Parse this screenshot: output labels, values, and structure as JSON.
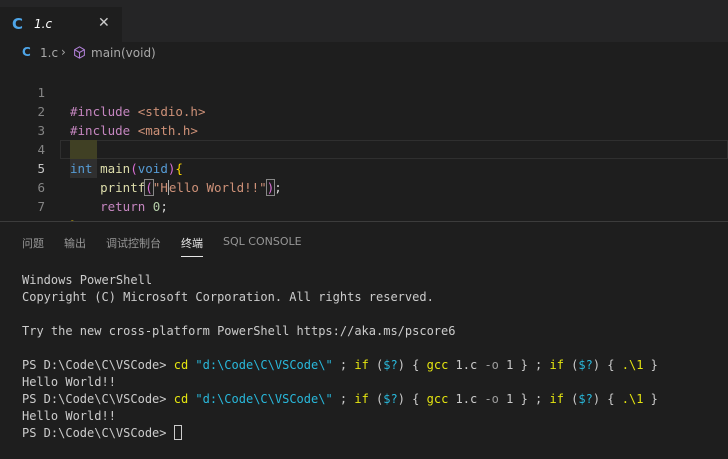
{
  "tab": {
    "icon": "c-language-icon",
    "icon_glyph": "C",
    "label": "1.c",
    "close_glyph": "✕"
  },
  "breadcrumb": {
    "file_icon_glyph": "C",
    "file": "1.c",
    "separator": "›",
    "symbol_icon": "cube-method-icon",
    "symbol": "main(void)"
  },
  "editor": {
    "active_line": 5,
    "lines": [
      {
        "number": "1",
        "text": "#include <stdio.h>"
      },
      {
        "number": "2",
        "text": "#include <math.h>"
      },
      {
        "number": "3",
        "text": ""
      },
      {
        "number": "4",
        "text": "int main(void){"
      },
      {
        "number": "5",
        "text": "    printf(\"Hello World!!\");"
      },
      {
        "number": "6",
        "text": "    return 0;"
      },
      {
        "number": "7",
        "text": "}"
      }
    ],
    "tokens": {
      "l1": {
        "directive": "#include",
        "header": "<stdio.h>"
      },
      "l2": {
        "directive": "#include",
        "header": "<math.h>"
      },
      "l4": {
        "type": "int",
        "name": "main",
        "open": "(",
        "param": "void",
        "close": ")",
        "brace": "{"
      },
      "l5": {
        "call": "printf",
        "open": "(",
        "str_a": "\"H",
        "str_b": "ello World!!\"",
        "close": ")",
        "semi": ";"
      },
      "l6": {
        "kw": "return",
        "val": "0",
        "semi": ";"
      },
      "l7": {
        "brace": "}"
      }
    }
  },
  "panel": {
    "tabs": [
      {
        "label": "问题",
        "active": false
      },
      {
        "label": "输出",
        "active": false
      },
      {
        "label": "调试控制台",
        "active": false
      },
      {
        "label": "终端",
        "active": true
      },
      {
        "label": "SQL CONSOLE",
        "active": false
      }
    ]
  },
  "terminal": {
    "banner": "Windows PowerShell",
    "copyright": "Copyright (C) Microsoft Corporation. All rights reserved.",
    "promo": "Try the new cross-platform PowerShell https://aka.ms/pscore6",
    "prompt": "PS D:\\Code\\C\\VSCode> ",
    "cmd": {
      "cd": "cd",
      "path": "\"d:\\Code\\C\\VSCode\\\"",
      "semi1": " ; ",
      "if1": "if",
      "cond1_open": " (",
      "cond1": "$?",
      "cond1_close": ") { ",
      "gcc": "gcc",
      "src": " 1.c ",
      "flag": "-o",
      "out": " 1 } ; ",
      "if2": "if",
      "cond2_open": " (",
      "cond2": "$?",
      "cond2_close": ") { ",
      "run": ".\\1",
      "end": " }"
    },
    "output": "Hello World!!"
  },
  "colors": {
    "background": "#1e1e1e",
    "tab_bar": "#252526",
    "accent_blue": "#4ea5e8",
    "terminal_yellow": "#e5e510",
    "terminal_cyan": "#29b8db"
  }
}
